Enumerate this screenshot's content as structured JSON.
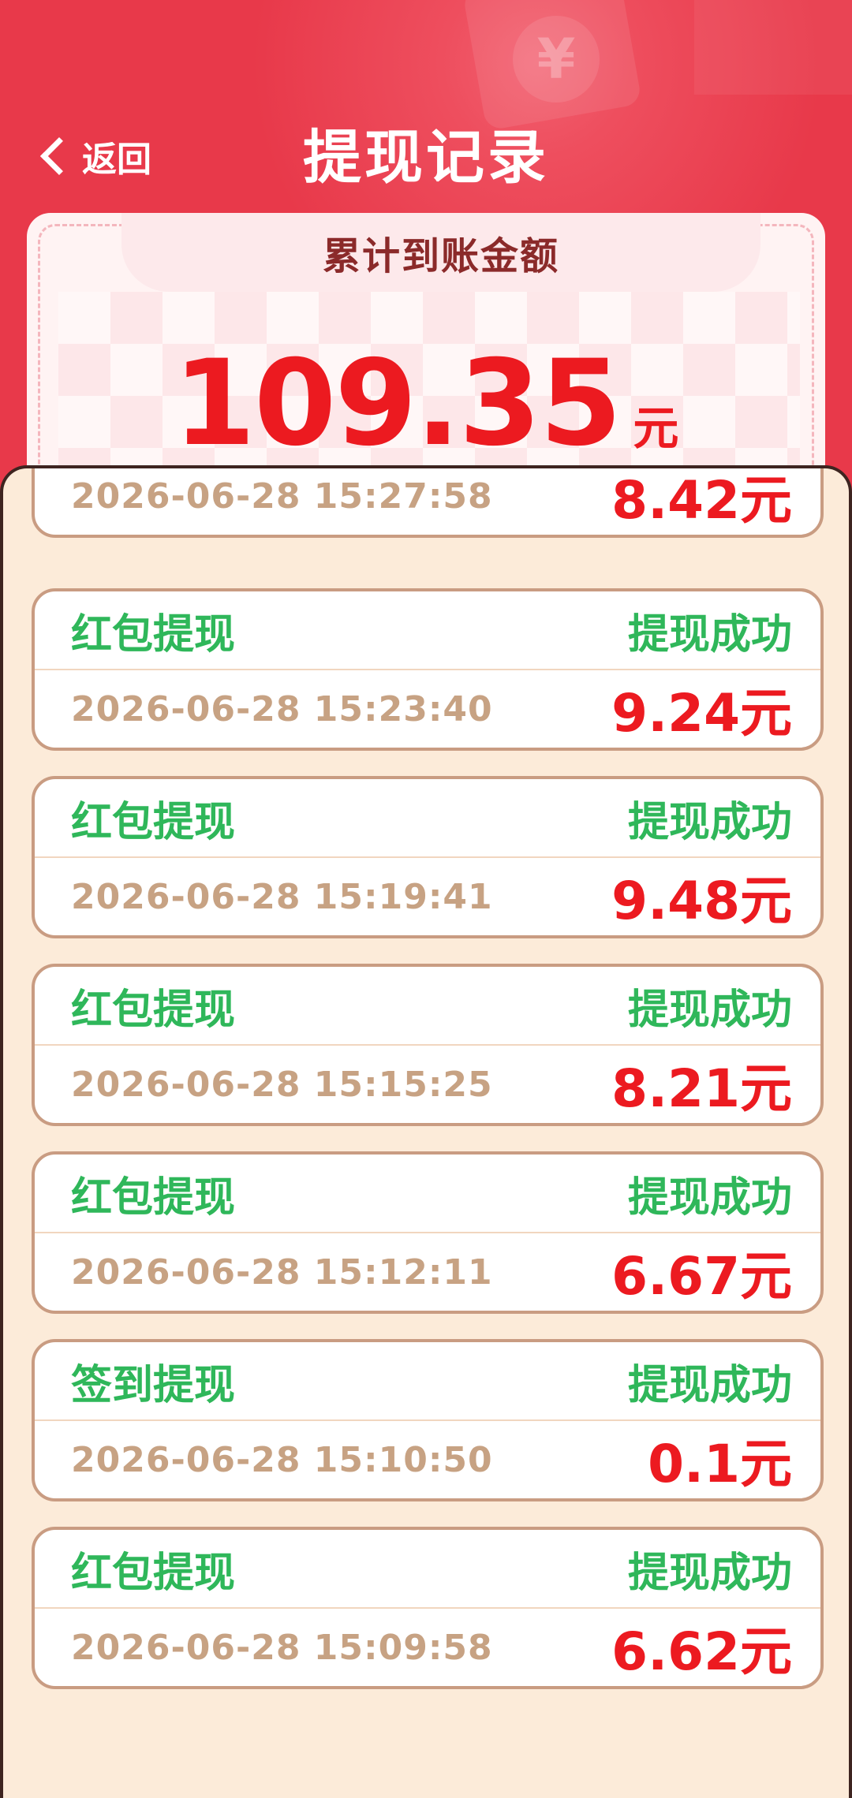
{
  "header": {
    "back_label": "返回",
    "title": "提现记录",
    "deco_yuan_symbol": "¥"
  },
  "summary": {
    "label": "累计到账金额",
    "amount": "109.35",
    "unit": "元"
  },
  "colors": {
    "brand_red": "#e8394a",
    "amount_red": "#ec1a20",
    "success_green": "#2fb75a",
    "time_tan": "#c7a283",
    "panel_bg": "#fcebd9"
  },
  "records": [
    {
      "type": "",
      "status": "",
      "time": "2026-06-28 15:27:58",
      "amount": "8.42元"
    },
    {
      "type": "红包提现",
      "status": "提现成功",
      "time": "2026-06-28 15:23:40",
      "amount": "9.24元"
    },
    {
      "type": "红包提现",
      "status": "提现成功",
      "time": "2026-06-28 15:19:41",
      "amount": "9.48元"
    },
    {
      "type": "红包提现",
      "status": "提现成功",
      "time": "2026-06-28 15:15:25",
      "amount": "8.21元"
    },
    {
      "type": "红包提现",
      "status": "提现成功",
      "time": "2026-06-28 15:12:11",
      "amount": "6.67元"
    },
    {
      "type": "签到提现",
      "status": "提现成功",
      "time": "2026-06-28 15:10:50",
      "amount": "0.1元"
    },
    {
      "type": "红包提现",
      "status": "提现成功",
      "time": "2026-06-28 15:09:58",
      "amount": "6.62元"
    }
  ]
}
